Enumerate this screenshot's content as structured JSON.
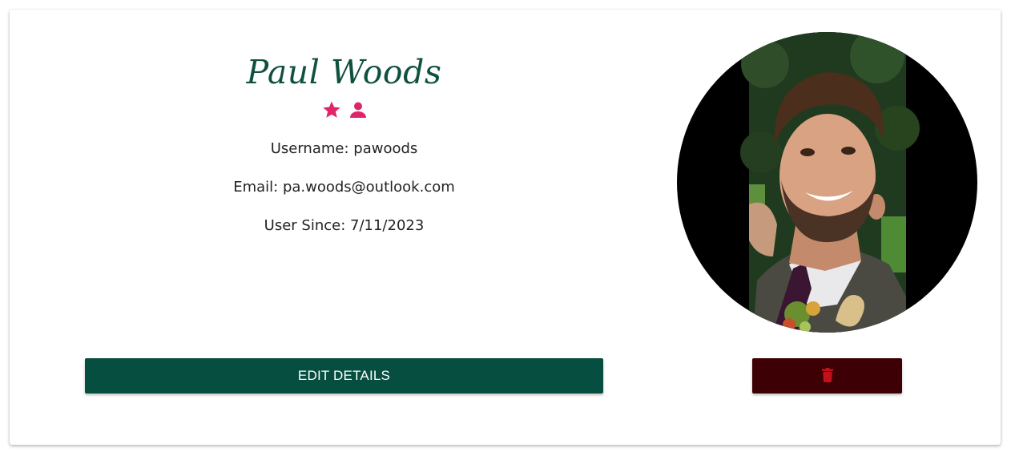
{
  "profile": {
    "name": "Paul Woods",
    "username_line": "Username: pawoods",
    "email_line": "Email: pa.woods@outlook.com",
    "since_line": "User Since: 7/11/2023"
  },
  "badges": [
    {
      "icon": "star-icon",
      "color": "#e0246a"
    },
    {
      "icon": "user-icon",
      "color": "#e0246a"
    }
  ],
  "actions": {
    "edit_label": "EDIT DETAILS",
    "delete_icon": "trash-icon",
    "delete_icon_color": "#c3111b"
  },
  "colors": {
    "brand_green": "#064e3f",
    "name_green": "#0f5140",
    "delete_bg": "#3d0004",
    "accent_pink": "#e0246a"
  }
}
